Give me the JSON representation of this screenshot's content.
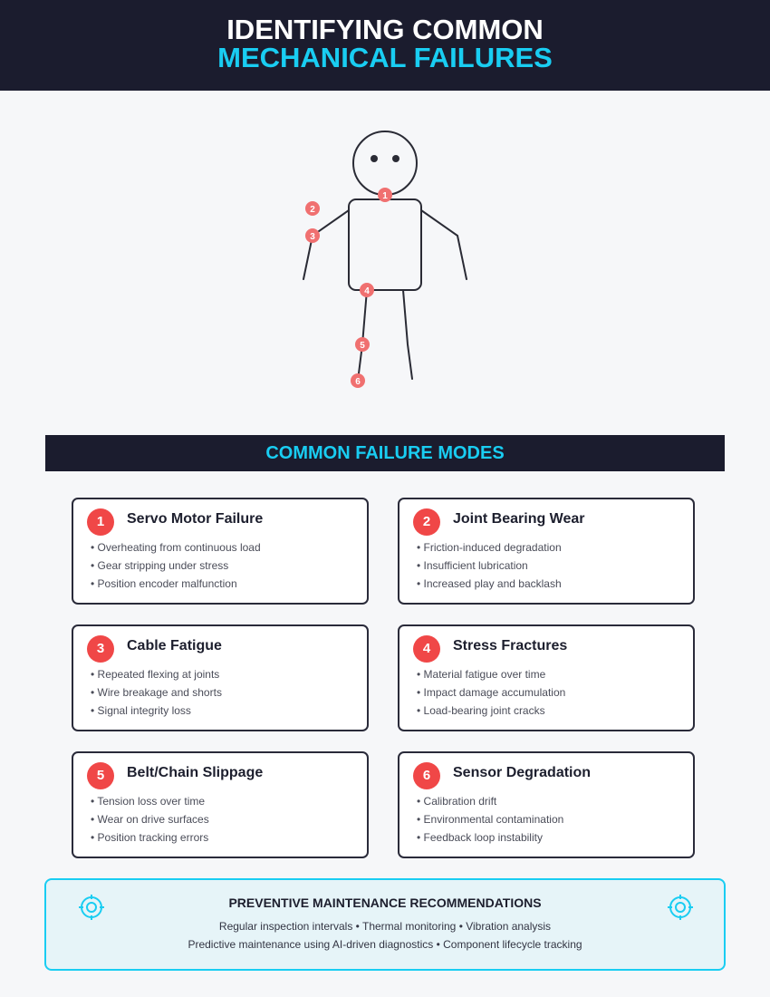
{
  "header": {
    "title_line1": "IDENTIFYING COMMON",
    "title_line2": "MECHANICAL FAILURES"
  },
  "figure": {
    "markers": [
      "1",
      "2",
      "3",
      "4",
      "5",
      "6"
    ]
  },
  "section": {
    "title": "COMMON FAILURE MODES"
  },
  "failures": [
    {
      "number": "1",
      "title": "Servo Motor Failure",
      "items": [
        "• Overheating from continuous load",
        "• Gear stripping under stress",
        "• Position encoder malfunction"
      ]
    },
    {
      "number": "2",
      "title": "Joint Bearing Wear",
      "items": [
        "• Friction-induced degradation",
        "• Insufficient lubrication",
        "• Increased play and backlash"
      ]
    },
    {
      "number": "3",
      "title": "Cable Fatigue",
      "items": [
        "• Repeated flexing at joints",
        "• Wire breakage and shorts",
        "• Signal integrity loss"
      ]
    },
    {
      "number": "4",
      "title": "Stress Fractures",
      "items": [
        "• Material fatigue over time",
        "• Impact damage accumulation",
        "• Load-bearing joint cracks"
      ]
    },
    {
      "number": "5",
      "title": "Belt/Chain Slippage",
      "items": [
        "• Tension loss over time",
        "• Wear on drive surfaces",
        "• Position tracking errors"
      ]
    },
    {
      "number": "6",
      "title": "Sensor Degradation",
      "items": [
        "• Calibration drift",
        "• Environmental contamination",
        "• Feedback loop instability"
      ]
    }
  ],
  "maintenance": {
    "title": "PREVENTIVE MAINTENANCE RECOMMENDATIONS",
    "line1": "Regular inspection intervals • Thermal monitoring • Vibration analysis",
    "line2": "Predictive maintenance using AI-driven diagnostics • Component lifecycle tracking",
    "icon": "target-icon"
  },
  "colors": {
    "dark": "#1b1c2e",
    "accent": "#19cdf2",
    "marker": "#f04747"
  }
}
